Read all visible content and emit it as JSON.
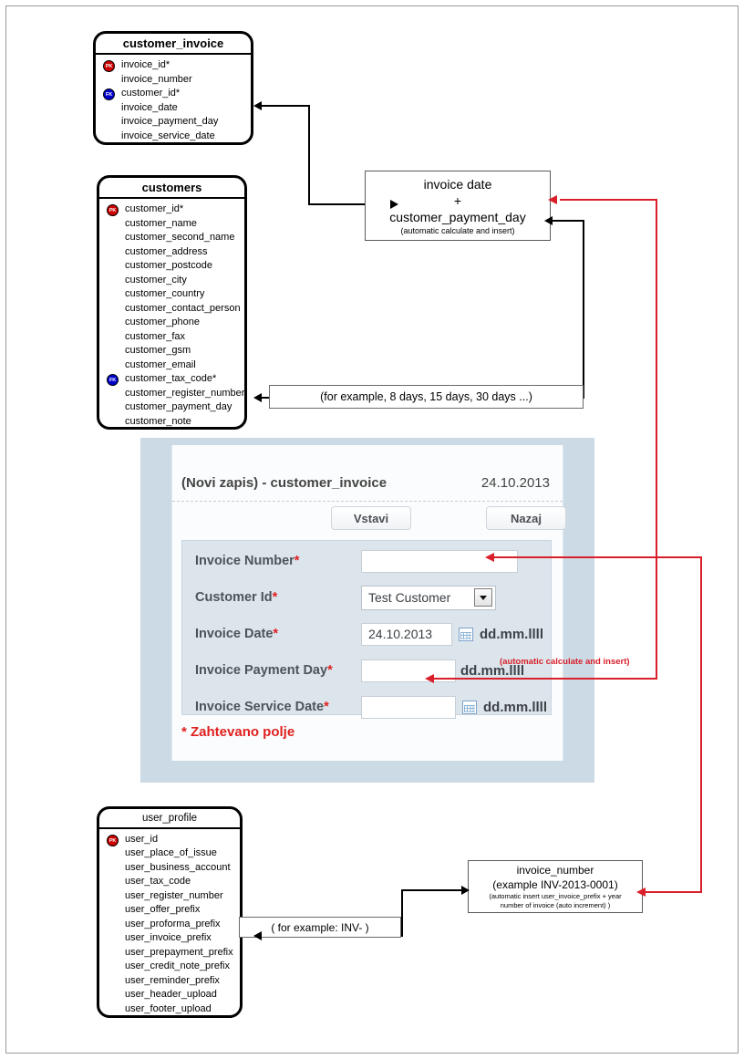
{
  "diagram": {
    "title": "customer_invoice ER and form flow diagram",
    "colors": {
      "pk": "#cc0000",
      "fk": "#0000cc",
      "flow_red": "#d81f2a",
      "flow_black": "#000000",
      "panel": "#ccdae5",
      "form_row": "#dce5ec"
    }
  },
  "entities": [
    {
      "name": "customer_invoice",
      "fields": [
        {
          "label": "invoice_id*",
          "key": "PK"
        },
        {
          "label": "invoice_number",
          "key": ""
        },
        {
          "label": "customer_id*",
          "key": "FK"
        },
        {
          "label": "invoice_date",
          "key": ""
        },
        {
          "label": "invoice_payment_day",
          "key": ""
        },
        {
          "label": "invoice_service_date",
          "key": ""
        }
      ]
    },
    {
      "name": "customers",
      "fields": [
        {
          "label": "customer_id*",
          "key": "PK"
        },
        {
          "label": "customer_name",
          "key": ""
        },
        {
          "label": "customer_second_name",
          "key": ""
        },
        {
          "label": "customer_address",
          "key": ""
        },
        {
          "label": "customer_postcode",
          "key": ""
        },
        {
          "label": "customer_city",
          "key": ""
        },
        {
          "label": "customer_country",
          "key": ""
        },
        {
          "label": "customer_contact_person",
          "key": ""
        },
        {
          "label": "customer_phone",
          "key": ""
        },
        {
          "label": "customer_fax",
          "key": ""
        },
        {
          "label": "customer_gsm",
          "key": ""
        },
        {
          "label": "customer_email",
          "key": ""
        },
        {
          "label": "customer_tax_code*",
          "key": "FK"
        },
        {
          "label": "customer_register_number",
          "key": ""
        },
        {
          "label": "customer_payment_day",
          "key": ""
        },
        {
          "label": "customer_note",
          "key": ""
        }
      ]
    },
    {
      "name": "user_profile",
      "fields": [
        {
          "label": "user_id",
          "key": "PK"
        },
        {
          "label": "user_place_of_issue",
          "key": ""
        },
        {
          "label": "user_business_account",
          "key": ""
        },
        {
          "label": "user_tax_code",
          "key": ""
        },
        {
          "label": "user_register_number",
          "key": ""
        },
        {
          "label": "user_offer_prefix",
          "key": ""
        },
        {
          "label": "user_proforma_prefix",
          "key": ""
        },
        {
          "label": "user_invoice_prefix",
          "key": ""
        },
        {
          "label": "user_prepayment_prefix",
          "key": ""
        },
        {
          "label": "user_credit_note_prefix",
          "key": ""
        },
        {
          "label": "user_reminder_prefix",
          "key": ""
        },
        {
          "label": "user_header_upload",
          "key": ""
        },
        {
          "label": "user_footer_upload",
          "key": ""
        }
      ]
    }
  ],
  "calc_box": {
    "line1": "invoice date",
    "line2": "+",
    "line3": "customer_payment_day",
    "subtext": "(automatic calculate and insert)"
  },
  "payment_day_note": "(for example, 8 days, 15 days, 30 days ...)",
  "invoice_prefix_note": "( for example:  INV- )",
  "invoice_number_box": {
    "line1": "invoice_number",
    "line2": "(example INV-2013-0001)",
    "line3": "(automatic insert user_invoice_prefix + year",
    "line4": "number of invoice  (auto increment) )"
  },
  "form": {
    "title": "(Novi zapis) - customer_invoice",
    "date": "24.10.2013",
    "buttons": {
      "insert": "Vstavi",
      "back": "Nazaj"
    },
    "rows": [
      {
        "label": "Invoice Number",
        "required": "*",
        "value": "",
        "format": ""
      },
      {
        "label": "Customer Id",
        "required": "*",
        "value": "Test Customer",
        "format": ""
      },
      {
        "label": "Invoice Date",
        "required": "*",
        "value": "24.10.2013",
        "format": "dd.mm.llll"
      },
      {
        "label": "Invoice Payment Day",
        "required": "*",
        "value": "",
        "format": "dd.mm.llll"
      },
      {
        "label": "Invoice Service Date",
        "required": "*",
        "value": "",
        "format": "dd.mm.llll"
      }
    ],
    "required_note": "* Zahtevano polje",
    "auto_note": "(automatic calculate and insert)"
  }
}
